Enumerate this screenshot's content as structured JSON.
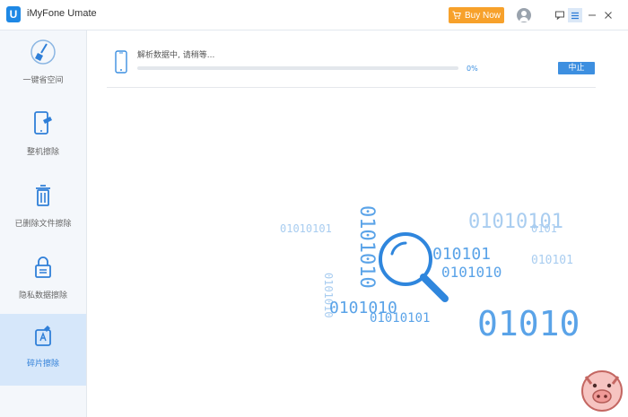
{
  "app": {
    "title": "iMyFone Umate",
    "logo_letter": "U"
  },
  "titlebar": {
    "buy_label": "Buy Now"
  },
  "sidebar": {
    "items": [
      {
        "label": "一键省空间"
      },
      {
        "label": "整机擦除"
      },
      {
        "label": "已删除文件擦除"
      },
      {
        "label": "隐私数据擦除"
      },
      {
        "label": "碎片擦除",
        "active": true
      }
    ]
  },
  "main": {
    "status_text": "解析数据中, 请稍等...",
    "progress": 0,
    "progress_label": "0%",
    "stop_label": "中止"
  },
  "illustration": {
    "lines": [
      {
        "text": "0101010",
        "accent": true
      },
      {
        "text": "01010101"
      },
      {
        "text": "010101",
        "accent": true
      },
      {
        "text": "0101010"
      },
      {
        "text": "0101010",
        "accent": true
      },
      {
        "text": "01010101"
      },
      {
        "text": "010101"
      },
      {
        "text": "0101010",
        "accent": true
      },
      {
        "text": "01010101",
        "accent": true
      },
      {
        "text": "01010",
        "accent": true
      },
      {
        "text": "0101"
      }
    ]
  },
  "colors": {
    "accent": "#3c8fe0",
    "buy": "#f7a12b",
    "active_nav": "#d6e7fa"
  }
}
